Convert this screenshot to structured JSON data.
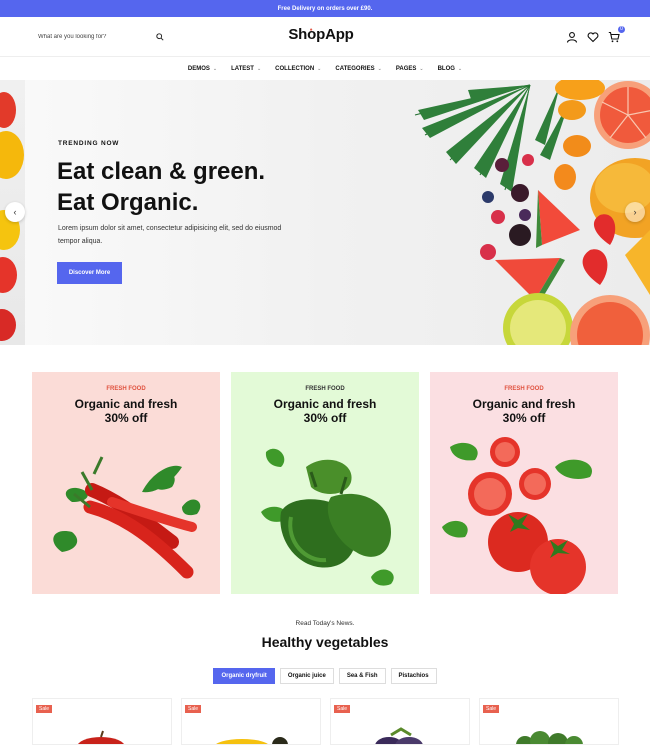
{
  "topbar": {
    "text": "Free Delivery on orders over £90."
  },
  "header": {
    "search_placeholder": "What are you looking for?",
    "logo_part1": "Sh",
    "logo_part2": "pApp",
    "cart_count": "0"
  },
  "nav": [
    {
      "label": "DEMOS"
    },
    {
      "label": "LATEST"
    },
    {
      "label": "COLLECTION"
    },
    {
      "label": "CATEGORIES"
    },
    {
      "label": "PAGES"
    },
    {
      "label": "BLOG"
    }
  ],
  "hero": {
    "subtitle": "TRENDING NOW",
    "title_line1": "Eat clean & green.",
    "title_line2": "Eat Organic.",
    "description": "Lorem ipsum dolor sit amet, consectetur adipisicing elit, sed do eiusmod tempor aliqua.",
    "button": "Discover More"
  },
  "promo_cards": [
    {
      "tag": "FRESH FOOD",
      "title_line1": "Organic and fresh",
      "title_line2": "30% off",
      "bg": "#fbdcd7",
      "tag_color": "#e0523f",
      "product": "red-chili-peppers"
    },
    {
      "tag": "FRESH FOOD",
      "title_line1": "Organic and fresh",
      "title_line2": "30% off",
      "bg": "#e3fad7",
      "tag_color": "#333333",
      "product": "green-bell-peppers"
    },
    {
      "tag": "FRESH FOOD",
      "title_line1": "Organic and fresh",
      "title_line2": "30% off",
      "bg": "#fbdfe2",
      "tag_color": "#e0523f",
      "product": "tomatoes"
    }
  ],
  "section": {
    "pretitle": "Read Today's News.",
    "title": "Healthy vegetables",
    "tabs": [
      {
        "label": "Organic dryfruit",
        "active": true
      },
      {
        "label": "Organic juice",
        "active": false
      },
      {
        "label": "Sea & Fish",
        "active": false
      },
      {
        "label": "Pistachios",
        "active": false
      }
    ]
  },
  "products": [
    {
      "badge": "Sale",
      "item": "red-apple"
    },
    {
      "badge": "Sale",
      "item": "yellow-pepper"
    },
    {
      "badge": "Sale",
      "item": "eggplant"
    },
    {
      "badge": "Sale",
      "item": "broccoli"
    }
  ],
  "colors": {
    "accent": "#5566ee",
    "sale": "#e8614f"
  }
}
